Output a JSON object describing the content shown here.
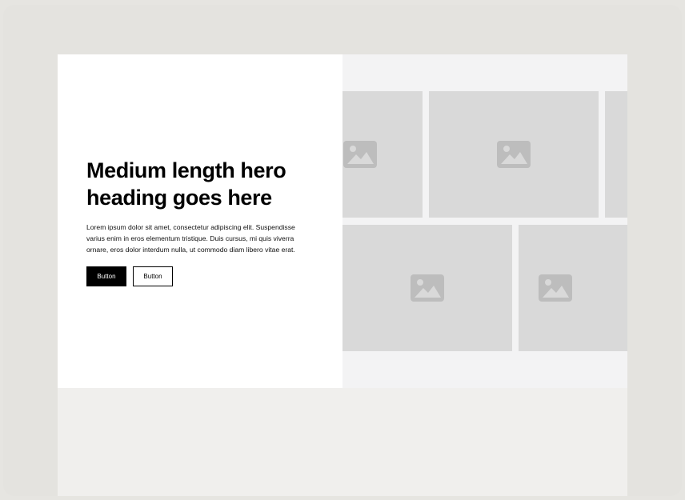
{
  "hero": {
    "heading": "Medium length hero heading goes here",
    "text": "Lorem ipsum dolor sit amet, consectetur adipiscing elit. Suspendisse varius enim in eros elementum tristique. Duis cursus, mi quis viverra ornare, eros dolor interdum nulla, ut commodo diam libero vitae erat.",
    "primary_button": "Button",
    "secondary_button": "Button"
  },
  "gallery": {
    "tile_icon": "image-placeholder-icon",
    "tile_color": "#d9d9d9",
    "icon_color": "#bdbdbd"
  },
  "colors": {
    "page_bg": "#e6e5e1",
    "hero_right_bg": "#f3f3f4",
    "lower_bg": "#f0efed"
  }
}
